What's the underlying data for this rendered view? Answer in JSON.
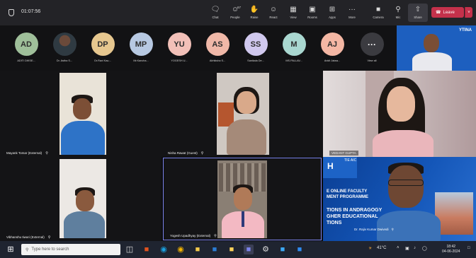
{
  "meeting": {
    "timer": "01:07:56",
    "toolbar": [
      {
        "label": "Chat",
        "icon": "chat-icon"
      },
      {
        "label": "People",
        "icon": "people-icon",
        "count": "67"
      },
      {
        "label": "Raise",
        "icon": "raise-hand-icon"
      },
      {
        "label": "React",
        "icon": "react-icon"
      },
      {
        "label": "View",
        "icon": "view-icon"
      },
      {
        "label": "Rooms",
        "icon": "rooms-icon"
      },
      {
        "label": "Apps",
        "icon": "apps-icon"
      },
      {
        "label": "More",
        "icon": "more-icon"
      },
      {
        "label": "Camera",
        "icon": "camera-icon"
      },
      {
        "label": "Mic",
        "icon": "mic-off-icon"
      },
      {
        "label": "Share",
        "icon": "share-icon"
      }
    ],
    "leave_label": "Leave",
    "leave_color": "#c4314b"
  },
  "participants_strip": [
    {
      "initials": "AD",
      "name": "ADITI DIKSE...",
      "color": "#9fbf9a"
    },
    {
      "initials": "",
      "name": "Dr. Astha S...",
      "color": "#444444"
    },
    {
      "initials": "DP",
      "name": "Dr.Ravi Kau...",
      "color": "#e6c78f"
    },
    {
      "initials": "MP",
      "name": "Mr.Kancha...",
      "color": "#b7c9e2"
    },
    {
      "initials": "YU",
      "name": "YOGESH U...",
      "color": "#f2c0b8"
    },
    {
      "initials": "AS",
      "name": "Abhiksha S...",
      "color": "#f0b8a8"
    },
    {
      "initials": "SS",
      "name": "Sanikala De...",
      "color": "#d0c8ee"
    },
    {
      "initials": "M",
      "name": "MS.PALLAV...",
      "color": "#a9d7d0"
    },
    {
      "initials": "AJ",
      "name": "Ankit Jaiwa...",
      "color": "#f4b7a4"
    },
    {
      "initials": "···",
      "name": "View all",
      "color": "#3b3b40"
    }
  ],
  "video_tiles": [
    {
      "name": "Mayank Tomar (External)"
    },
    {
      "name": "Nisha Rawat (Guest)"
    },
    {
      "name": "VEDANT GUPTA"
    },
    {
      "name": "Vibhanshu tiwari (External)"
    },
    {
      "name": "Yogesh Upadhyay (External)"
    }
  ],
  "host_tile": {
    "logo_text": "YTINA"
  },
  "slide": {
    "tag": "TIE AIC",
    "lines": [
      "E ONLINE FACULTY",
      "MENT PROGRAMME",
      "TIONS IN ANDRAGOGY",
      "GHER EDUCATIONAL",
      "TIONS"
    ],
    "speaker": "Dr. Rajiv Kumar Dwivedi"
  },
  "taskbar": {
    "search_placeholder": "Type here to search",
    "weather": "41°C",
    "time": "18:42",
    "date": "04-06-2024"
  }
}
